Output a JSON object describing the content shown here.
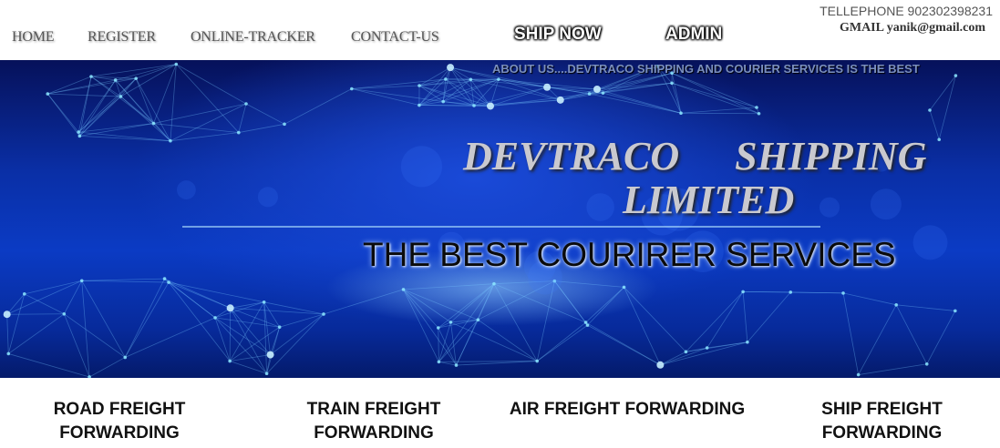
{
  "nav": {
    "links": [
      "HOME",
      "REGISTER",
      "ONLINE-TRACKER",
      "CONTACT-US"
    ],
    "ship_now": "SHIP NOW",
    "admin": "ADMIN"
  },
  "contact": {
    "phone": "TELLEPHONE 902302398231",
    "email": "GMAIL yanik@gmail.com"
  },
  "hero": {
    "marquee": "ABOUT US....DEVTRACO SHIPPING AND COURIER SERVICES IS THE BEST",
    "title_line1": "DEVTRACO SHIPPING",
    "title_line2": "LIMITED",
    "tagline": "THE BEST COURIRER SERVICES"
  },
  "services": [
    "ROAD FREIGHT FORWARDING",
    "TRAIN FREIGHT FORWARDING",
    "AIR FREIGHT FORWARDING",
    "SHIP FREIGHT FORWARDING"
  ],
  "colors": {
    "hero_blue": "#0b3bc4",
    "nav_text": "#555555"
  }
}
